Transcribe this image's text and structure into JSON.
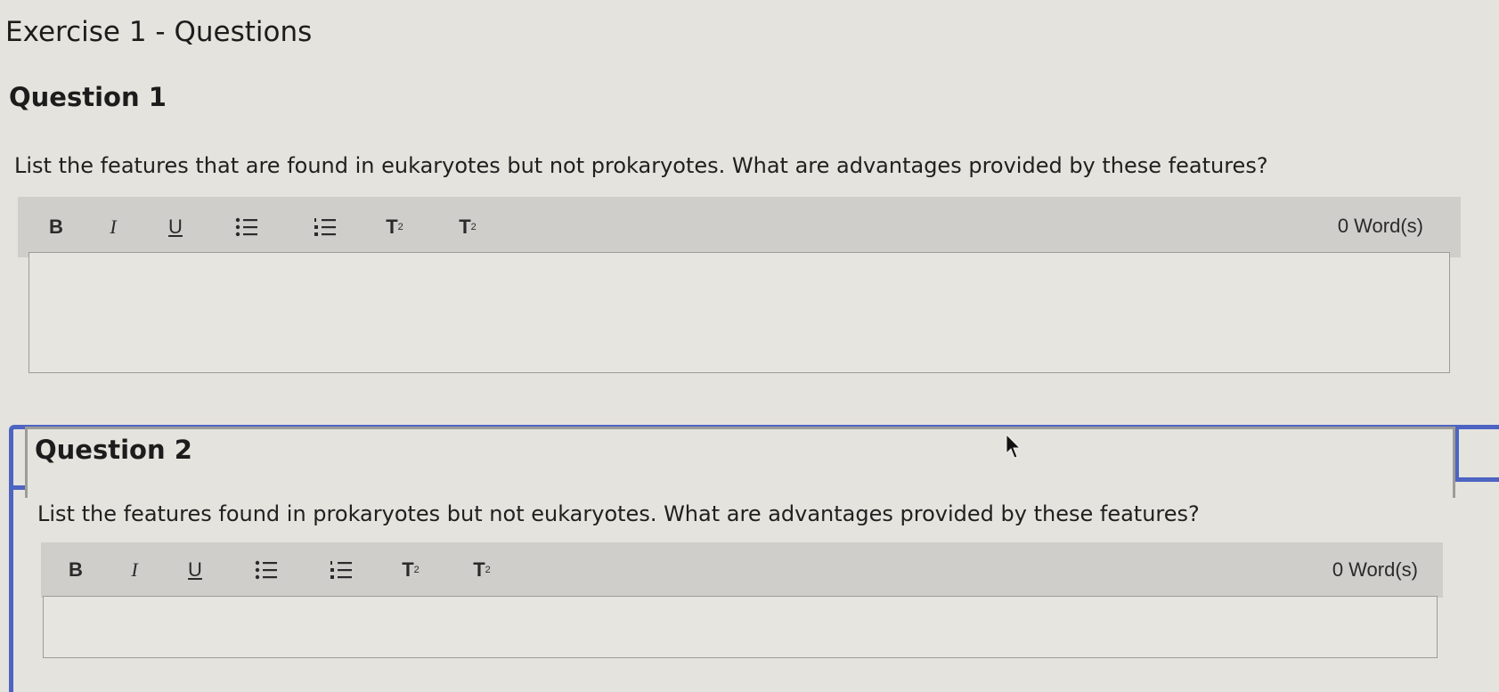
{
  "page": {
    "title": "Exercise 1 - Questions"
  },
  "questions": [
    {
      "heading": "Question 1",
      "prompt": "List the features that are found in eukaryotes but not prokaryotes. What are advantages provided by these features?",
      "toolbar": {
        "bold": "B",
        "italic": "I",
        "underline": "U",
        "superscript": "T",
        "subscript": "T",
        "word_count": "0 Word(s)"
      }
    },
    {
      "heading": "Question 2",
      "prompt": "List the features found in prokaryotes but not eukaryotes. What are advantages provided by these features?",
      "toolbar": {
        "bold": "B",
        "italic": "I",
        "underline": "U",
        "superscript": "T",
        "subscript": "T",
        "word_count": "0 Word(s)"
      }
    }
  ],
  "icons": {
    "bullet_list": "bullet-list-icon",
    "numbered_list": "numbered-list-icon",
    "cursor": "mouse-pointer-icon"
  },
  "colors": {
    "active_border": "#4e64c2",
    "toolbar_bg": "#cfcecb",
    "page_bg": "#e4e3dd"
  }
}
